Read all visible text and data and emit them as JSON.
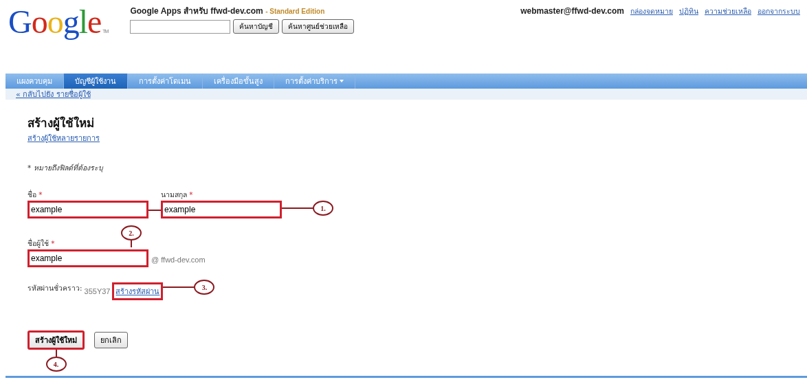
{
  "header": {
    "logo": "Google",
    "tm": "TM",
    "title": "Google Apps สำหรับ ffwd-dev.com",
    "separator": "-",
    "edition": "Standard Edition",
    "search_buttons": [
      "ค้นหาบัญชี",
      "ค้นหาศูนย์ช่วยเหลือ"
    ],
    "user": "webmaster@ffwd-dev.com",
    "links": [
      "กล่องจดหมาย",
      "ปฏิทิน",
      "ความช่วยเหลือ",
      "ออกจากระบบ"
    ]
  },
  "nav": {
    "tabs": [
      {
        "label": "แผงควบคุม",
        "selected": false,
        "has_menu": false
      },
      {
        "label": "บัญชีผู้ใช้งาน",
        "selected": true,
        "has_menu": false
      },
      {
        "label": "การตั้งค่าโดเมน",
        "selected": false,
        "has_menu": false
      },
      {
        "label": "เครื่องมือขั้นสูง",
        "selected": false,
        "has_menu": false
      },
      {
        "label": "การตั้งค่าบริการ",
        "selected": false,
        "has_menu": true
      }
    ]
  },
  "back_link": "« กลับไปยัง รายชื่อผู้ใช้",
  "form": {
    "title": "สร้างผู้ใช้ใหม่",
    "bulk_link": "สร้างผู้ใช้หลายรายการ",
    "required_note": "* หมายถึงฟิลด์ที่ต้องระบุ",
    "first_name": {
      "label": "ชื่อ",
      "required_mark": "*",
      "value": "example",
      "annotated": true
    },
    "last_name": {
      "label": "นามสกุล",
      "required_mark": "*",
      "value": "example",
      "annotated": true,
      "callout": "1."
    },
    "username": {
      "label": "ชื่อผู้ใช้",
      "required_mark": "*",
      "value": "example",
      "annotated": true,
      "callout": "2.",
      "domain": "@ ffwd-dev.com"
    },
    "password": {
      "label": "รหัสผ่านชั่วคราว:",
      "value": "355Y37",
      "link": "สร้างรหัสผ่าน",
      "annotated": true,
      "callout": "3."
    },
    "buttons": [
      {
        "label": "สร้างผู้ใช้ใหม่",
        "kind": "primary",
        "annotated": true,
        "callout": "4."
      },
      {
        "label": "ยกเลิก",
        "kind": "secondary",
        "annotated": false
      }
    ]
  }
}
